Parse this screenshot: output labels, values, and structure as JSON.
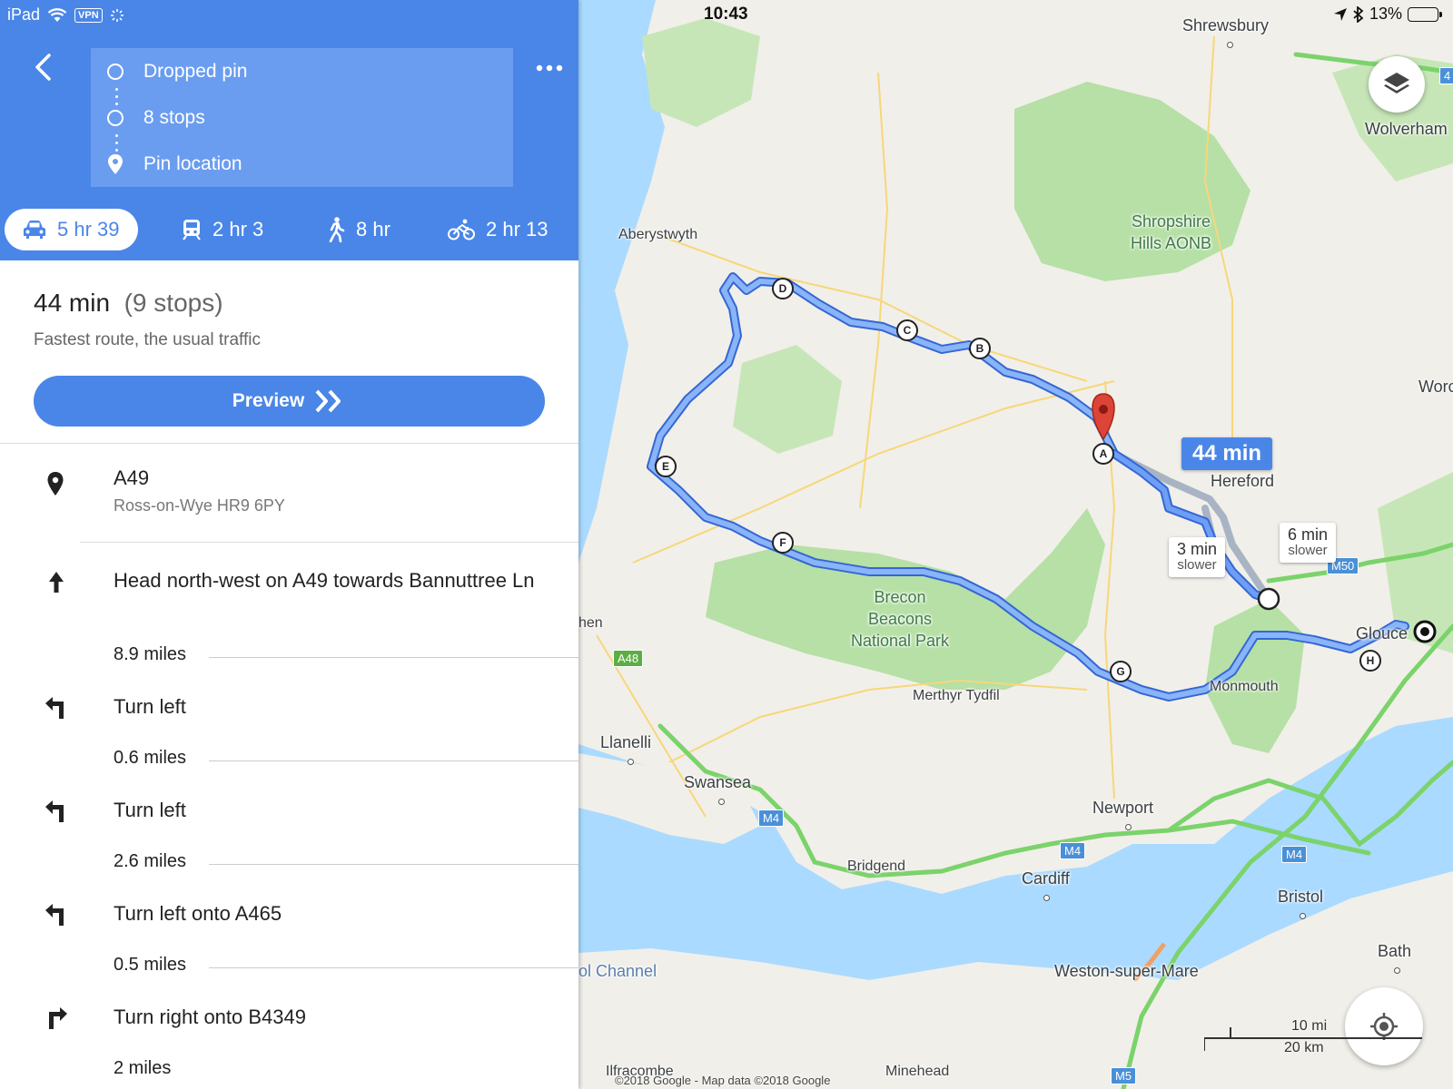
{
  "status_bar": {
    "device": "iPad",
    "vpn": "VPN",
    "time": "10:43",
    "battery": "13%"
  },
  "directions": {
    "waypoints": [
      "Dropped pin",
      "8 stops",
      "Pin location"
    ],
    "modes": [
      {
        "icon": "car-icon",
        "label": "5 hr 39",
        "active": true
      },
      {
        "icon": "train-icon",
        "label": "2 hr 3",
        "active": false
      },
      {
        "icon": "walk-icon",
        "label": "8 hr",
        "active": false
      },
      {
        "icon": "bike-icon",
        "label": "2 hr 13",
        "active": false
      }
    ],
    "summary": {
      "duration": "44 min",
      "stops": "(9 stops)",
      "description": "Fastest route, the usual traffic"
    },
    "preview_label": "Preview",
    "origin": {
      "title": "A49",
      "address": "Ross-on-Wye HR9 6PY"
    },
    "steps": [
      {
        "icon": "arrow-up-icon",
        "instruction": "Head north-west on A49 towards Bannuttree Ln",
        "distance": "8.9 miles"
      },
      {
        "icon": "turn-left-icon",
        "instruction": "Turn left",
        "distance": "0.6 miles"
      },
      {
        "icon": "turn-left-icon",
        "instruction": "Turn left",
        "distance": "2.6 miles"
      },
      {
        "icon": "turn-left-icon",
        "instruction": "Turn left onto A465",
        "distance": "0.5 miles"
      },
      {
        "icon": "turn-right-icon",
        "instruction": "Turn right onto B4349",
        "distance": "2 miles"
      }
    ]
  },
  "map": {
    "places": {
      "shrewsbury": "Shrewsbury",
      "wolverhampton": "Wolverham",
      "worcester": "Worc",
      "aberystwyth": "Aberystwyth",
      "shropshire": "Shropshire\nHills AONB",
      "hereford": "Hereford",
      "brecon": "Brecon\nBeacons\nNational Park",
      "carmarthen": "hen",
      "merthyr": "Merthyr Tydfil",
      "monmouth": "Monmouth",
      "gloucester": "Glouce",
      "llanelli": "Llanelli",
      "swansea": "Swansea",
      "newport": "Newport",
      "bridgend": "Bridgend",
      "cardiff": "Cardiff",
      "bristol": "Bristol",
      "bath": "Bath",
      "weston": "Weston-super-Mare",
      "channel": "ol Channel",
      "ilfracombe": "Ilfracombe",
      "minehead": "Minehead"
    },
    "roads": [
      "A48",
      "M4",
      "M4",
      "M4",
      "M50",
      "M5",
      "4"
    ],
    "stops": [
      "A",
      "B",
      "C",
      "D",
      "E",
      "F",
      "G",
      "H"
    ],
    "route_label": "44 min",
    "alternates": [
      {
        "time": "3 min",
        "note": "slower"
      },
      {
        "time": "6 min",
        "note": "slower"
      }
    ],
    "scale": {
      "miles": "10 mi",
      "km": "20 km"
    },
    "copyright": "©2018 Google - Map data ©2018 Google",
    "colors": {
      "route": "#4a86e8",
      "route_casing": "#3367d6",
      "alternate": "#a8b4c4",
      "motorway": "#7bd36b",
      "park": "#b6e0a6",
      "water": "#aadaff",
      "land": "#f1efe9"
    }
  }
}
